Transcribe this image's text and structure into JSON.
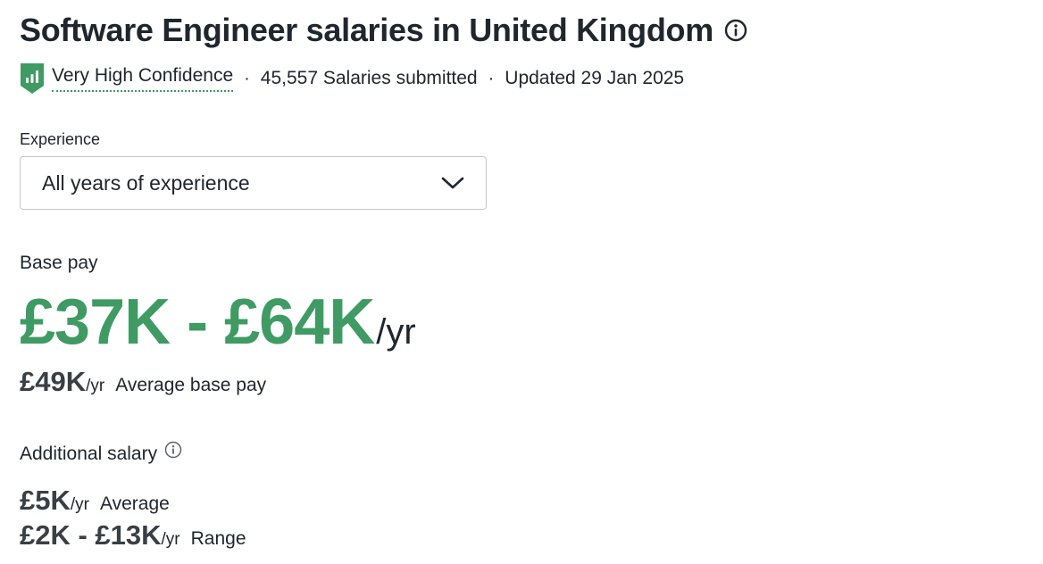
{
  "header": {
    "title": "Software Engineer salaries in United Kingdom",
    "info_icon": "info-icon"
  },
  "meta": {
    "confidence_icon": "signal-shield-icon",
    "confidence": "Very High Confidence",
    "separator": "·",
    "salaries_submitted": "45,557 Salaries submitted",
    "updated": "Updated 29 Jan 2025"
  },
  "experience": {
    "label": "Experience",
    "selected": "All years of experience",
    "dropdown_icon": "chevron-down-icon"
  },
  "base_pay": {
    "label": "Base pay",
    "range": "£37K - £64K",
    "range_unit": "/yr",
    "average": "£49K",
    "average_unit": "/yr",
    "average_label": "Average base pay"
  },
  "additional_salary": {
    "label": "Additional salary",
    "info_icon": "info-icon",
    "average": "£5K",
    "average_unit": "/yr",
    "average_label": "Average",
    "range": "£2K - £13K",
    "range_unit": "/yr",
    "range_label": "Range"
  },
  "colors": {
    "accent_green": "#3f9b63",
    "text": "#20262e"
  }
}
